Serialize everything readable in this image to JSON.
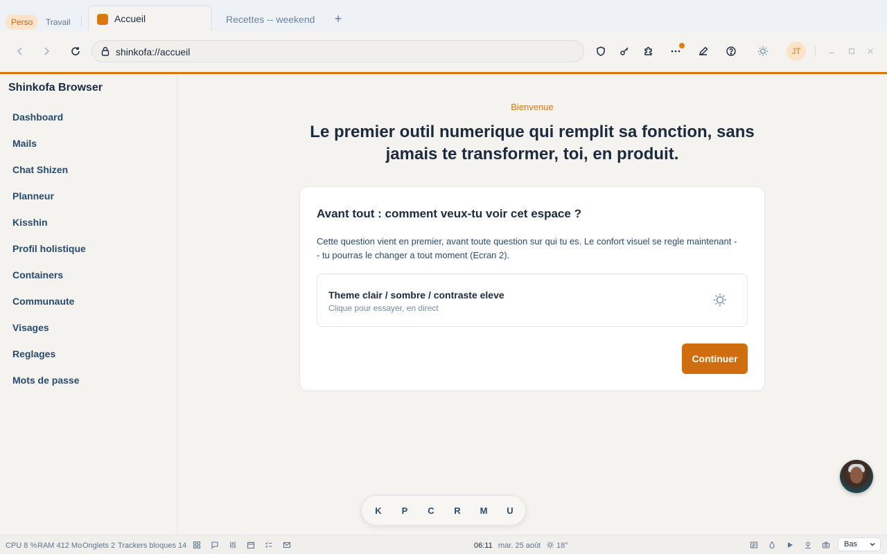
{
  "tabs": {
    "profiles": [
      "Perso",
      "Travail"
    ],
    "active_tab": "Accueil",
    "inactive_tab": "Recettes -- weekend",
    "new_tab_label": "+"
  },
  "toolbar": {
    "url": "shinkofa://accueil",
    "avatar_initials": "JT",
    "icons": [
      "back-icon",
      "forward-icon",
      "reload-icon",
      "lock-icon",
      "shield-icon",
      "key-icon",
      "puzzle-icon",
      "more-icon",
      "pen-icon",
      "help-icon",
      "sun-icon",
      "minimize-icon",
      "maximize-icon",
      "close-icon"
    ]
  },
  "sidebar": {
    "title": "Shinkofa Browser",
    "items": [
      "Dashboard",
      "Mails",
      "Chat Shizen",
      "Planneur",
      "Kisshin",
      "Profil holistique",
      "Containers",
      "Communaute",
      "Visages",
      "Reglages",
      "Mots de passe"
    ]
  },
  "main": {
    "eyebrow": "Bienvenue",
    "headline": "Le premier outil numerique qui remplit sa fonction, sans jamais te transformer, toi, en produit.",
    "card": {
      "title": "Avant tout : comment veux-tu voir cet espace ?",
      "description": "Cette question vient en premier, avant toute question sur qui tu es. Le confort visuel se regle maintenant -- tu pourras le changer a tout moment (Ecran 2).",
      "option_title": "Theme clair / sombre / contraste eleve",
      "option_subtitle": "Clique pour essayer, en direct",
      "continue_label": "Continuer"
    }
  },
  "dock": {
    "items": [
      "K",
      "P",
      "C",
      "R",
      "M",
      "U"
    ]
  },
  "statusbar": {
    "cpu": "CPU 8 %",
    "ram": "RAM 412 Mo",
    "tabs": "Onglets 2",
    "trackers": "Trackers bloques 14",
    "time": "06:11",
    "date": "mar. 25 août",
    "weather": "18°",
    "position_select": "Bas"
  },
  "colors": {
    "accent": "#d97811",
    "button": "#cf6d0f",
    "text": "#1b2a3f",
    "nav_text": "#274b6e",
    "background": "#f5f3ef"
  }
}
